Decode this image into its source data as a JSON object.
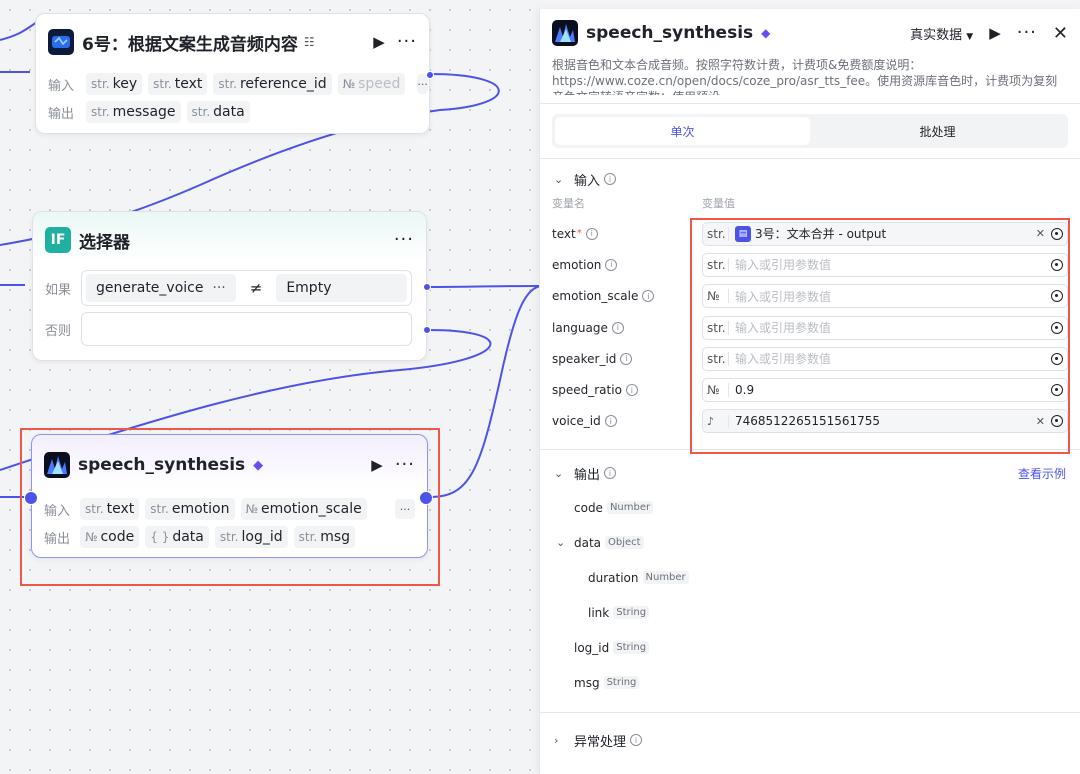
{
  "canvas": {
    "node_audio": {
      "title": "6号：根据文案生成音频内容",
      "input_label": "输入",
      "output_label": "输出",
      "inputs": [
        {
          "type": "str.",
          "name": "key"
        },
        {
          "type": "str.",
          "name": "text"
        },
        {
          "type": "str.",
          "name": "reference_id"
        },
        {
          "type": "№",
          "name": "speed"
        }
      ],
      "outputs": [
        {
          "type": "str.",
          "name": "message"
        },
        {
          "type": "str.",
          "name": "data"
        }
      ]
    },
    "node_selector": {
      "icon_text": "IF",
      "title": "选择器",
      "if_label": "如果",
      "else_label": "否则",
      "left_operand": "generate_voice",
      "left_more": "···",
      "operator": "≠",
      "right_operand": "Empty"
    },
    "node_speech": {
      "title": "speech_synthesis",
      "input_label": "输入",
      "output_label": "输出",
      "inputs": [
        {
          "type": "str.",
          "name": "text"
        },
        {
          "type": "str.",
          "name": "emotion"
        },
        {
          "type": "№",
          "name": "emotion_scale"
        }
      ],
      "outputs": [
        {
          "type": "№",
          "name": "code"
        },
        {
          "type": "{ }",
          "name": "data"
        },
        {
          "type": "str.",
          "name": "log_id"
        },
        {
          "type": "str.",
          "name": "msg"
        }
      ]
    }
  },
  "panel": {
    "title": "speech_synthesis",
    "data_mode": "真实数据",
    "description": "根据音色和文本合成音频。按照字符数计费，计费项&免费额度说明：https://www.coze.cn/open/docs/coze_pro/asr_tts_fee。使用资源库音色时，计费项为复刻音色文字转语音字数；使用预设…",
    "tabs": [
      "单次",
      "批处理"
    ],
    "input_section": "输入",
    "col_name": "变量名",
    "col_value": "变量值",
    "params": [
      {
        "name": "text",
        "type": "str.",
        "value": "3号：文本合并 - output",
        "required": true,
        "ref": true
      },
      {
        "name": "emotion",
        "type": "str.",
        "placeholder": "输入或引用参数值"
      },
      {
        "name": "emotion_scale",
        "type": "№",
        "placeholder": "输入或引用参数值"
      },
      {
        "name": "language",
        "type": "str.",
        "placeholder": "输入或引用参数值"
      },
      {
        "name": "speaker_id",
        "type": "str.",
        "placeholder": "输入或引用参数值"
      },
      {
        "name": "speed_ratio",
        "type": "№",
        "value": "0.9"
      },
      {
        "name": "voice_id",
        "type": "voice",
        "value": "7468512265151561755",
        "clearable": true
      }
    ],
    "output_section": "输出",
    "view_example": "查看示例",
    "outputs": [
      {
        "name": "code",
        "type": "Number",
        "level": 0
      },
      {
        "name": "data",
        "type": "Object",
        "level": 0,
        "expanded": true
      },
      {
        "name": "duration",
        "type": "Number",
        "level": 1
      },
      {
        "name": "link",
        "type": "String",
        "level": 1
      },
      {
        "name": "log_id",
        "type": "String",
        "level": 0
      },
      {
        "name": "msg",
        "type": "String",
        "level": 0
      }
    ],
    "error_section": "异常处理"
  },
  "colors": {
    "accent": "#4d53e8",
    "highlight": "#f0574b",
    "selector": "#1fb0a1"
  }
}
